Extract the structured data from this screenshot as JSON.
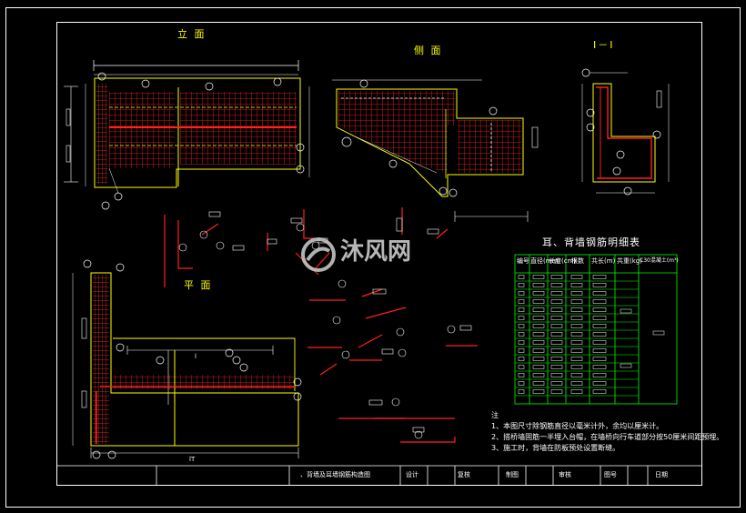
{
  "views": {
    "elevation_title": "立 面",
    "side_title": "侧 面",
    "section_title": "I－I",
    "plan_title": "平 面"
  },
  "schedule": {
    "title": "耳、背墙钢筋明细表",
    "headers": [
      "编号",
      "直径(mm)",
      "长度(cm)",
      "根数",
      "共长(m)",
      "共重(kg)",
      "C30混凝土(m³)"
    ]
  },
  "dimension_labels": {
    "plan_l": "l",
    "plan_lt": "lT"
  },
  "notes": {
    "heading": "注",
    "items": [
      "1、本图尺寸除钢筋直径以毫米计外，余均以厘米计。",
      "2、搭桥墙固筋一半埋入台帽，在墙桥向行车道部分按50厘米间距预埋。",
      "3、施工时，背墙在防板预处设置断缝。"
    ]
  },
  "title_block": {
    "drawing_name": "、背墙及耳墙钢筋构造图",
    "design": "设计",
    "review": "复核",
    "draw": "制图",
    "approve": "审核",
    "figure_no": "图号",
    "date": "日期"
  },
  "watermark": "沐风网",
  "colors": {
    "background": "#000000",
    "frame": "#ffffff",
    "rebar": "#ff2020",
    "concrete": "#ffff00",
    "dim": "#ffffff",
    "table": "#00ff00"
  }
}
